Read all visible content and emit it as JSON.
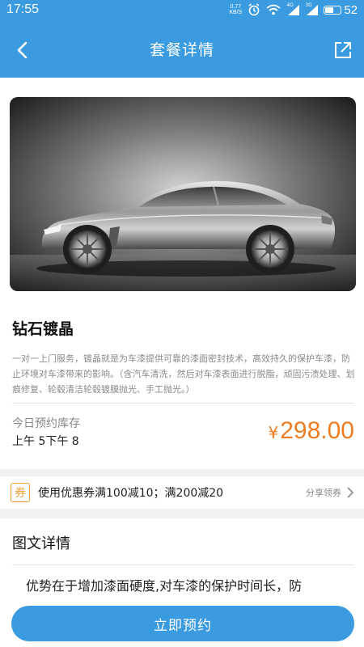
{
  "status_bar": {
    "time": "17:55",
    "net_speed": "0.77",
    "net_unit": "KB/S",
    "signal1_label": "4G",
    "signal2_label": "3G",
    "battery": "52"
  },
  "header": {
    "title": "套餐详情",
    "back_icon": "chevron-left-icon",
    "share_icon": "share-external-icon"
  },
  "product": {
    "name": "钻石镀晶",
    "description": "一对一上门服务，镀晶就是为车漆提供可靠的漆面密封技术，高效持久的保护车漆，防止环境对车漆带来的影响。（含汽车清洗，然后对车漆表面进行脱脂，顽固污渍处理、划痕修复、轮毂清洁轮毂镀膜抛光、手工抛光。）",
    "stock_label": "今日预约库存",
    "stock_value": "上午 5下午 8",
    "currency": "¥",
    "price": "298.00",
    "price_color": "#ee7d22"
  },
  "coupon": {
    "badge": "券",
    "text": "使用优惠券满100减10；满200减20",
    "link": "分享领券"
  },
  "detail": {
    "title": "图文详情",
    "body": "优势在于增加漆面硬度,对车漆的保护时间长，防"
  },
  "actions": {
    "book_label": "立即预约"
  },
  "colors": {
    "primary": "#3a9be0",
    "accent": "#ee7d22",
    "coupon": "#f0a23c"
  }
}
